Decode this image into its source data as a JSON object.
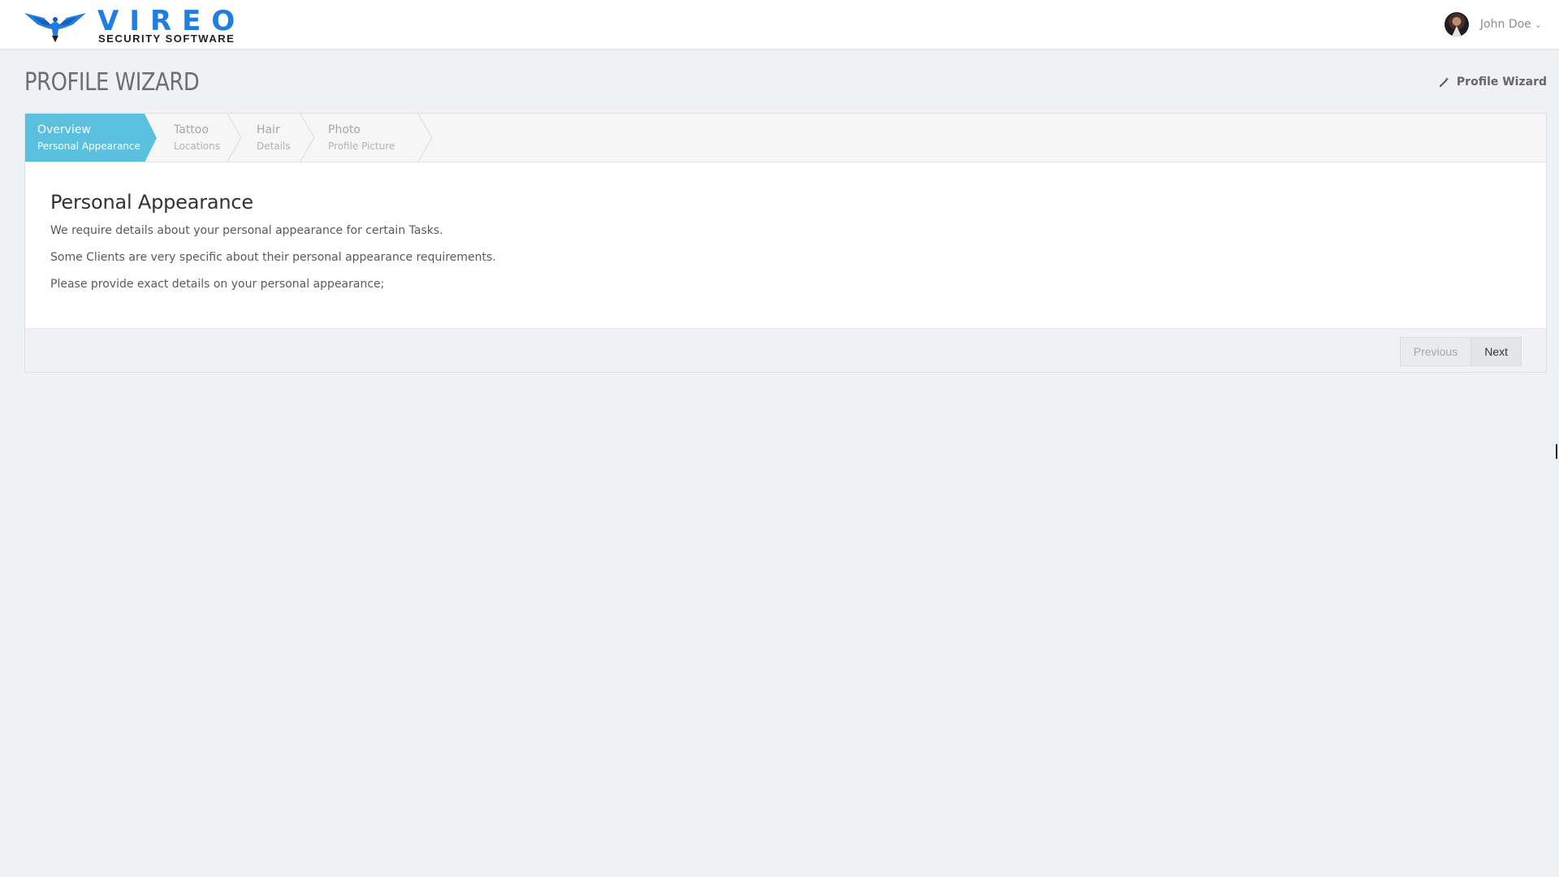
{
  "header": {
    "brand_name": "VIREO",
    "brand_tagline": "SECURITY SOFTWARE",
    "user_name": "John Doe",
    "user_caret": "⌄"
  },
  "page": {
    "title": "PROFILE WIZARD",
    "breadcrumb_label": "Profile Wizard",
    "breadcrumb_icon": "magic-wand-icon"
  },
  "wizard": {
    "active_step": 0,
    "steps": [
      {
        "title": "Overview",
        "subtitle": "Personal Appearance"
      },
      {
        "title": "Tattoo",
        "subtitle": "Locations"
      },
      {
        "title": "Hair",
        "subtitle": "Details"
      },
      {
        "title": "Photo",
        "subtitle": "Profile Picture"
      }
    ],
    "heading": "Personal Appearance",
    "paragraphs": [
      "We require details about your personal appearance for certain Tasks.",
      "Some Clients are very specific about their personal appearance requirements.",
      "Please provide exact details on your personal appearance;"
    ],
    "previous_label": "Previous",
    "next_label": "Next"
  },
  "colors": {
    "accent": "#5bc0de",
    "brand": "#1f7ee0",
    "background": "#f0f1f5"
  }
}
